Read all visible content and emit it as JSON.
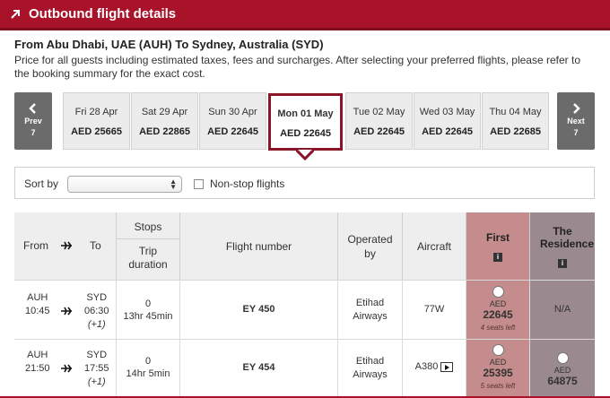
{
  "header": {
    "title": "Outbound flight details"
  },
  "route": "From Abu Dhabi, UAE (AUH) To Sydney, Australia (SYD)",
  "info": "Price for all guests including estimated taxes, fees and surcharges. After selecting your preferred flights, please refer to the booking summary for the exact cost.",
  "prev": {
    "label": "Prev",
    "count": "7"
  },
  "next": {
    "label": "Next",
    "count": "7"
  },
  "dates": [
    {
      "label": "Fri 28 Apr",
      "price": "AED 25665"
    },
    {
      "label": "Sat 29 Apr",
      "price": "AED 22865"
    },
    {
      "label": "Sun 30 Apr",
      "price": "AED 22645"
    },
    {
      "label": "Mon 01 May",
      "price": "AED 22645"
    },
    {
      "label": "Tue 02 May",
      "price": "AED 22645"
    },
    {
      "label": "Wed 03 May",
      "price": "AED 22645"
    },
    {
      "label": "Thu 04 May",
      "price": "AED 22685"
    }
  ],
  "sort": {
    "label": "Sort by",
    "selected": "",
    "nonstop_label": "Non-stop flights"
  },
  "table": {
    "headers": {
      "from": "From",
      "to": "To",
      "stops": "Stops",
      "duration": "Trip duration",
      "flight_number": "Flight number",
      "operated_by": "Operated by",
      "aircraft": "Aircraft",
      "first": "First",
      "residence": "The Residence",
      "info_glyph": "i"
    },
    "rows": [
      {
        "from_code": "AUH",
        "from_time": "10:45",
        "to_code": "SYD",
        "to_time": "06:30",
        "day_offset": "(+1)",
        "stops": "0",
        "duration": "13hr 45min",
        "flight": "EY 450",
        "operator": "Etihad Airways",
        "aircraft": "77W",
        "first_currency": "AED",
        "first_price": "22645",
        "first_seats": "4 seats left",
        "residence": "N/A"
      },
      {
        "from_code": "AUH",
        "from_time": "21:50",
        "to_code": "SYD",
        "to_time": "17:55",
        "day_offset": "(+1)",
        "stops": "0",
        "duration": "14hr 5min",
        "flight": "EY 454",
        "operator": "Etihad Airways",
        "aircraft": "A380",
        "first_currency": "AED",
        "first_price": "25395",
        "first_seats": "5 seats left",
        "residence_currency": "AED",
        "residence_price": "64875"
      }
    ]
  },
  "colors": {
    "brand": "#a8132a",
    "selected_border": "#8b1528",
    "first_col": "#c48c8c",
    "residence_col": "#9a8a90"
  }
}
